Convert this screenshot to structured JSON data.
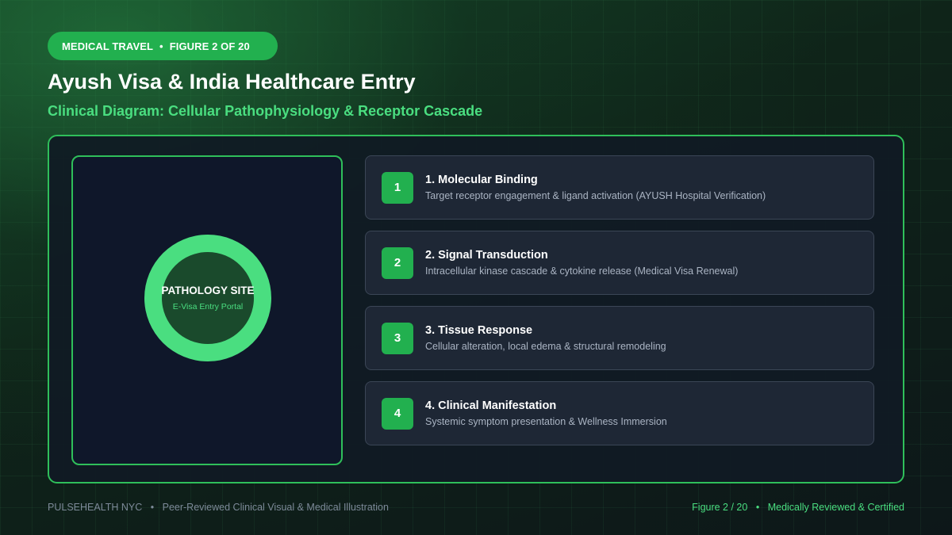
{
  "header": {
    "badge_category": "MEDICAL TRAVEL",
    "badge_separator": "•",
    "badge_figure": "FIGURE 2 OF 20",
    "title": "Ayush Visa & India Healthcare Entry",
    "subtitle": "Clinical Diagram: Cellular Pathophysiology & Receptor Cascade"
  },
  "diagram": {
    "site_label": "PATHOLOGY SITE",
    "site_sublabel": "E-Visa Entry Portal"
  },
  "steps": [
    {
      "number": "1",
      "title": "1. Molecular Binding",
      "description": "Target receptor engagement & ligand activation (AYUSH Hospital Verification)"
    },
    {
      "number": "2",
      "title": "2. Signal Transduction",
      "description": "Intracellular kinase cascade & cytokine release (Medical Visa Renewal)"
    },
    {
      "number": "3",
      "title": "3. Tissue Response",
      "description": "Cellular alteration, local edema & structural remodeling"
    },
    {
      "number": "4",
      "title": "4. Clinical Manifestation",
      "description": "Systemic symptom presentation & Wellness Immersion"
    }
  ],
  "footer": {
    "brand": "PULSEHEALTH NYC",
    "separator": "•",
    "tagline": "Peer-Reviewed Clinical Visual & Medical Illustration",
    "figure": "Figure 2 / 20",
    "certification": "Medically Reviewed & Certified"
  },
  "colors": {
    "accent": "#22b04f",
    "accent_light": "#4ade80",
    "panel_bg": "#0f172a",
    "card_bg": "#1e2735"
  }
}
